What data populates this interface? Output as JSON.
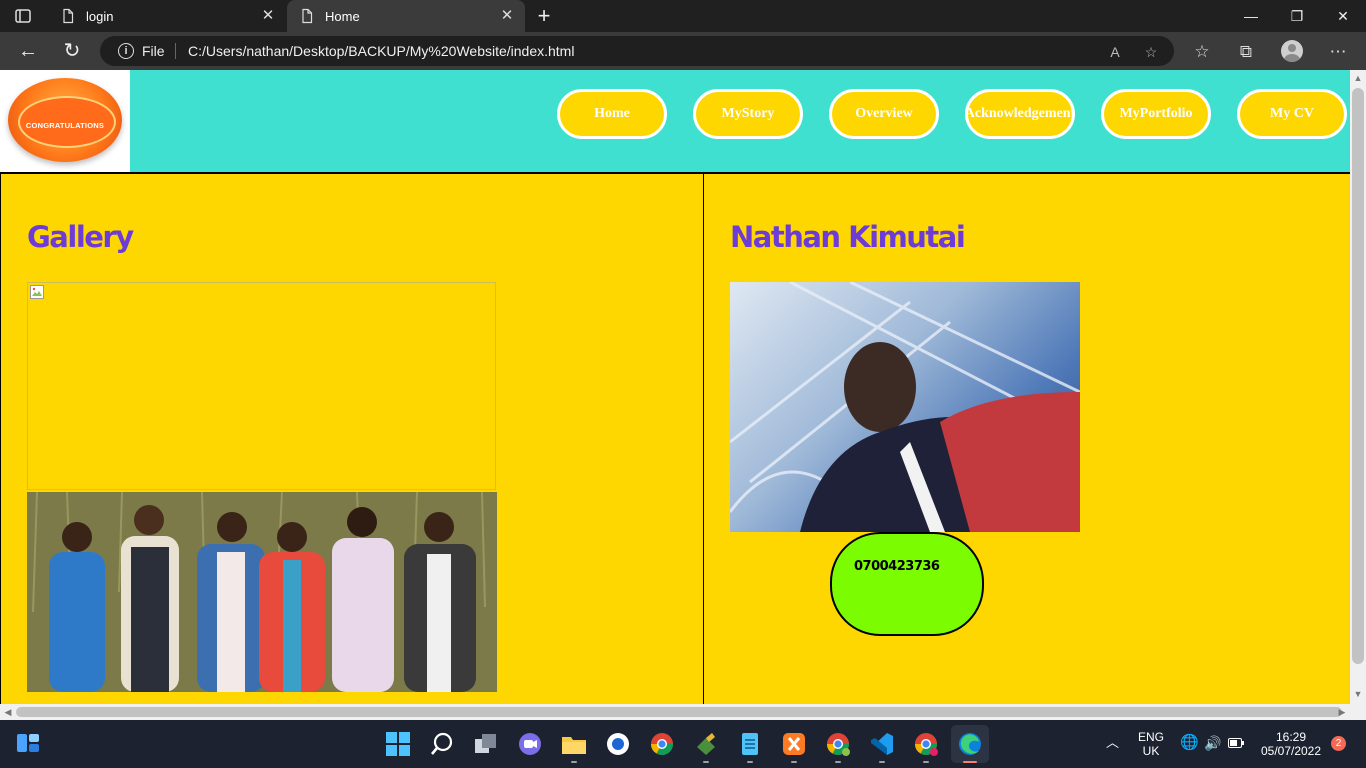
{
  "browser": {
    "tabs": [
      {
        "title": "login",
        "active": false
      },
      {
        "title": "Home",
        "active": true
      }
    ],
    "address": {
      "scheme_label": "File",
      "url": "C:/Users/nathan/Desktop/BACKUP/My%20Website/index.html"
    }
  },
  "page": {
    "colors": {
      "header_bg": "#40e0d0",
      "body_bg": "#ffd700",
      "heading": "#6c3bd8",
      "phone_bg": "#7cfc00"
    },
    "logo": {
      "text": "CONGRATULATIONS"
    },
    "nav": [
      {
        "label": "Home"
      },
      {
        "label": "MyStory"
      },
      {
        "label": "Overview"
      },
      {
        "label": "Acknowledgement"
      },
      {
        "label": "MyPortfolio"
      },
      {
        "label": "My CV"
      }
    ],
    "gallery": {
      "heading": "Gallery"
    },
    "profile": {
      "heading": "Nathan Kimutai",
      "phone": "0700423736"
    }
  },
  "taskbar": {
    "language": {
      "line1": "ENG",
      "line2": "UK"
    },
    "clock": {
      "time": "16:29",
      "date": "05/07/2022"
    },
    "notification_count": "2"
  }
}
